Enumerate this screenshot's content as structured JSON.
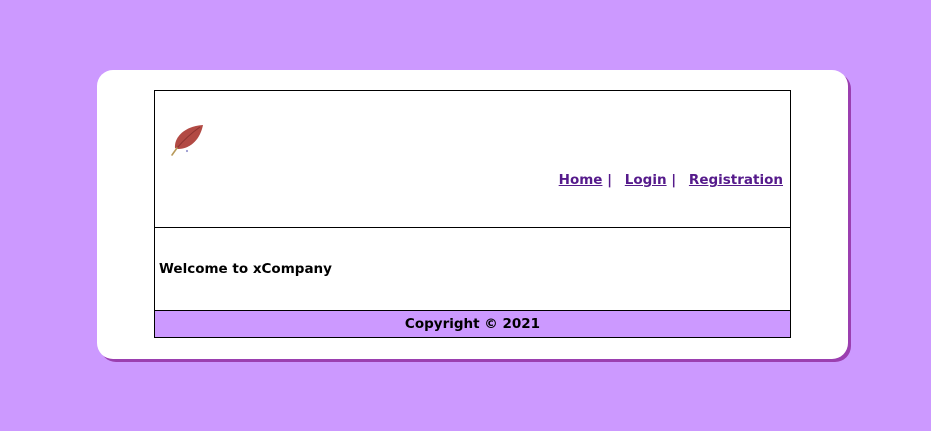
{
  "nav": {
    "items": [
      {
        "label": "Home",
        "separator": "|"
      },
      {
        "label": "Login",
        "separator": "|"
      },
      {
        "label": "Registration",
        "separator": ""
      }
    ]
  },
  "main": {
    "welcome": "Welcome to xCompany"
  },
  "footer": {
    "copyright": "Copyright © 2021"
  },
  "logo": {
    "icon": "leaf-icon"
  },
  "colors": {
    "background": "#cc99ff",
    "card": "#ffffff",
    "card_shadow": "#9b3fb0",
    "link": "#551a8b",
    "footer": "#cc99ff"
  }
}
